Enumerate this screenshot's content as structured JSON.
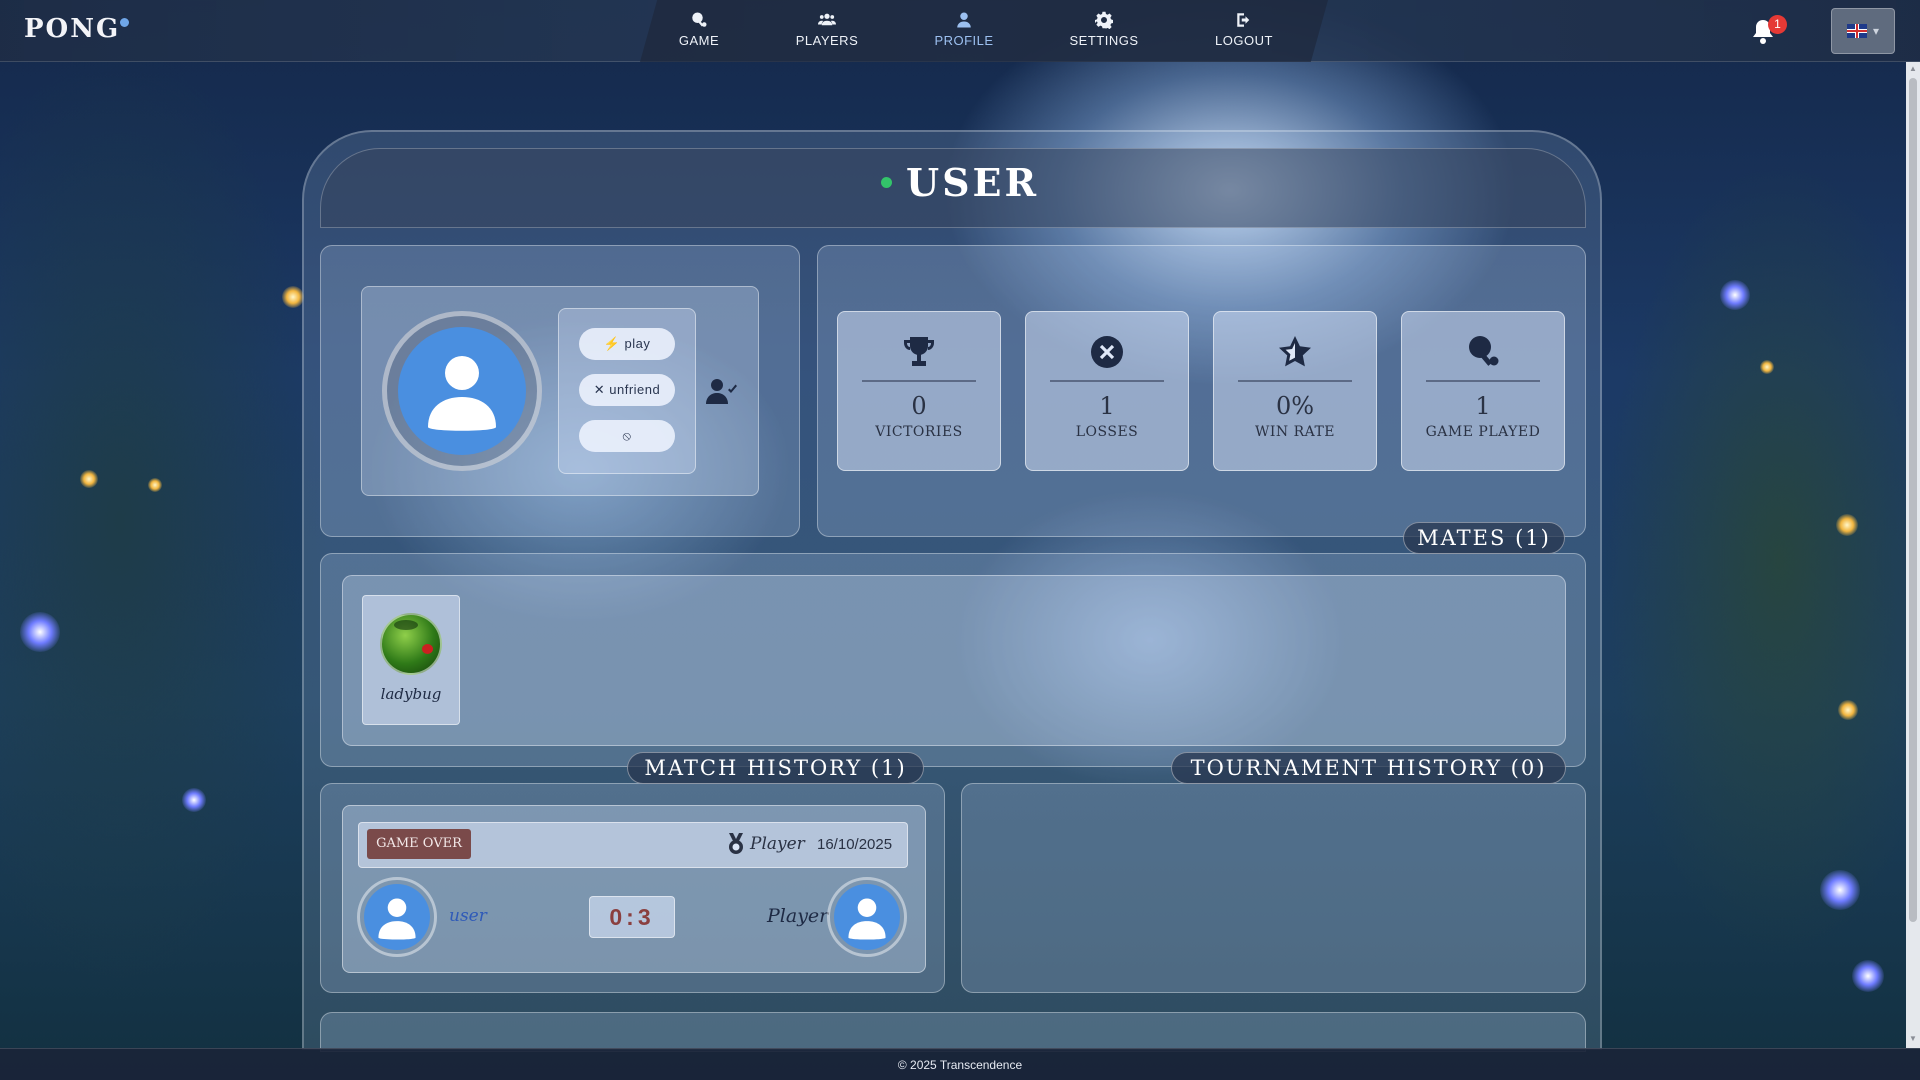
{
  "app": {
    "logo": "PONG"
  },
  "nav": {
    "items": [
      {
        "label": "GAME",
        "icon": "ping-pong-icon"
      },
      {
        "label": "PLAYERS",
        "icon": "users-icon"
      },
      {
        "label": "PROFILE",
        "icon": "user-icon"
      },
      {
        "label": "SETTINGS",
        "icon": "gear-icon"
      },
      {
        "label": "LOGOUT",
        "icon": "logout-icon"
      }
    ],
    "active": "PROFILE",
    "notification_count": "1",
    "language_flag": "uk-flag-icon",
    "language_caret": "▾"
  },
  "profile": {
    "username": "USER",
    "online_color": "#33c46a",
    "actions": {
      "play": "play",
      "unfriend": "unfriend",
      "block_icon": "block-icon"
    },
    "friend_status_icon": "user-check-icon"
  },
  "stats": [
    {
      "value": "0",
      "label": "VICTORIES",
      "icon": "trophy-icon"
    },
    {
      "value": "1",
      "label": "LOSSES",
      "icon": "x-circle-icon"
    },
    {
      "value": "0%",
      "label": "WIN RATE",
      "icon": "star-icon"
    },
    {
      "value": "1",
      "label": "GAME PLAYED",
      "icon": "ping-pong-icon"
    }
  ],
  "mates": {
    "heading": "MATES",
    "count": "(1)",
    "list": [
      {
        "name": "ladybug"
      }
    ]
  },
  "match_history": {
    "heading": "MATCH HISTORY",
    "count": "(1)",
    "matches": [
      {
        "status": "GAME OVER",
        "winner": "Player",
        "date": "16/10/2025",
        "left_player": "user",
        "right_player": "Player",
        "left_score": "0",
        "right_score": "3"
      }
    ]
  },
  "tournament_history": {
    "heading": "TOURNAMENT HISTORY",
    "count": "(0)"
  },
  "footer": {
    "text": "© 2025 Transcendence"
  }
}
